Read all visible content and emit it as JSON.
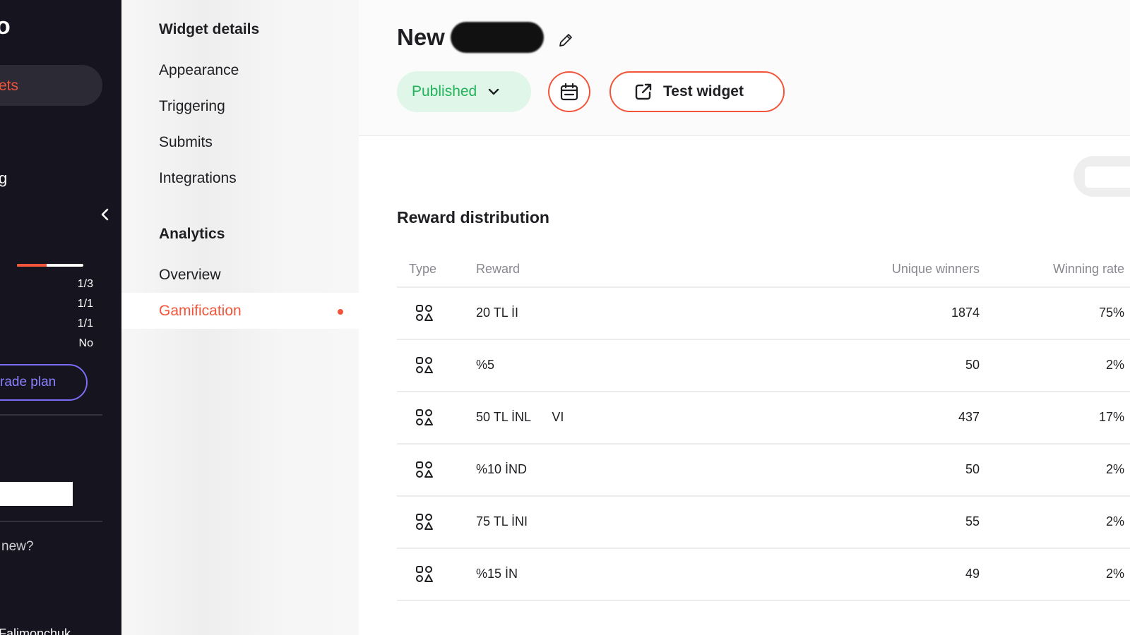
{
  "sidebar": {
    "logo_fragment": "o",
    "active_item_fragment": "ets",
    "item_fragment": "g",
    "usage_progress": 0.45,
    "usage_values": [
      "1/3",
      "1/1",
      "1/1",
      "No"
    ],
    "upgrade_label": "rade plan",
    "whats_new_fragment": "new?",
    "user_fragment": "Falimonchuk"
  },
  "subnav": {
    "widget_details_heading": "Widget details",
    "items": [
      "Appearance",
      "Triggering",
      "Submits",
      "Integrations"
    ],
    "analytics_heading": "Analytics",
    "analytics_items": [
      "Overview",
      "Gamification"
    ],
    "active_item": "Gamification"
  },
  "header": {
    "title": "New",
    "status": "Published",
    "test_label": "Test widget"
  },
  "reward": {
    "title": "Reward distribution",
    "columns": [
      "Type",
      "Reward",
      "Unique winners",
      "Winning rate"
    ],
    "rows": [
      {
        "reward": "20 TL İI",
        "winners": "1874",
        "rate": "75%"
      },
      {
        "reward": "%5",
        "winners": "50",
        "rate": "2%"
      },
      {
        "reward": "50 TL İNL      VI",
        "winners": "437",
        "rate": "17%"
      },
      {
        "reward": "%10 İND",
        "winners": "50",
        "rate": "2%"
      },
      {
        "reward": "75 TL İNI",
        "winners": "55",
        "rate": "2%"
      },
      {
        "reward": "%15 İN",
        "winners": "49",
        "rate": "2%"
      }
    ]
  },
  "colors": {
    "accent": "#f2553b",
    "success": "#23b35a",
    "sidebar_bg": "#16151f",
    "upgrade": "#7b6cf6"
  },
  "icons": [
    "chevron-left-icon",
    "pencil-icon",
    "chevron-down-icon",
    "calendar-icon",
    "external-link-icon",
    "shapes-icon"
  ]
}
